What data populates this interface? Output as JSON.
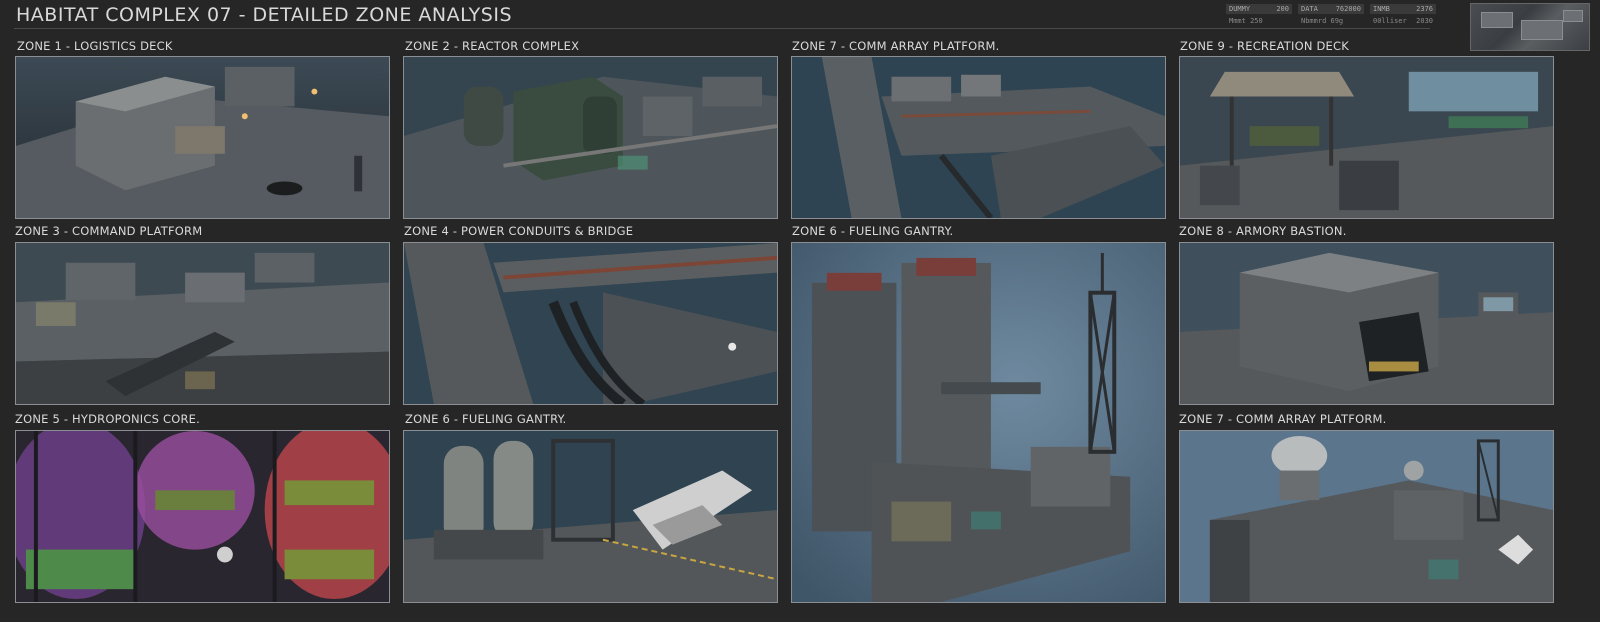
{
  "header": {
    "title": "HABITAT COMPLEX 07  - DETAILED ZONE ANALYSIS",
    "stats": [
      {
        "label": "DUMMY",
        "value": "200"
      },
      {
        "label": "DATA",
        "value": "762000"
      },
      {
        "label": "INMB",
        "value": "2376"
      },
      {
        "label": "Mmmt 250",
        "value": ""
      },
      {
        "label": "Nbmmrd 69g",
        "value": ""
      },
      {
        "label": "00lliser",
        "value": "2030"
      }
    ]
  },
  "zones": [
    {
      "label": "ZONE 1 - LOGISTICS DECK",
      "theme": "#3c4a55"
    },
    {
      "label": "ZONE 2 - REACTOR COMPLEX",
      "theme": "#34454f"
    },
    {
      "label": "ZONE 7 - COMM ARRAY PLATFORM.",
      "theme": "#2f4452"
    },
    {
      "label": "ZONE 9 - RECREATION DECK",
      "theme": "#3b4750"
    },
    {
      "label": "ZONE 3 - COMMAND PLATFORM",
      "theme": "#3e4a52"
    },
    {
      "label": "ZONE 4 - POWER CONDUITS & BRIDGE",
      "theme": "#304452"
    },
    {
      "label": "ZONE 6 - FUELING GANTRY.",
      "theme": "#4f6a80"
    },
    {
      "label": "ZONE 8 - ARMORY BASTION.",
      "theme": "#3f4f5b"
    },
    {
      "label": "ZONE 5 - HYDROPONICS CORE.",
      "theme": "#4a2e4f"
    },
    {
      "label": "ZONE 6 - FUELING GANTRY.",
      "theme": "#2f4350"
    },
    {
      "label": "ZONE 7 - COMM ARRAY PLATFORM.",
      "theme": "#5a758c"
    }
  ]
}
